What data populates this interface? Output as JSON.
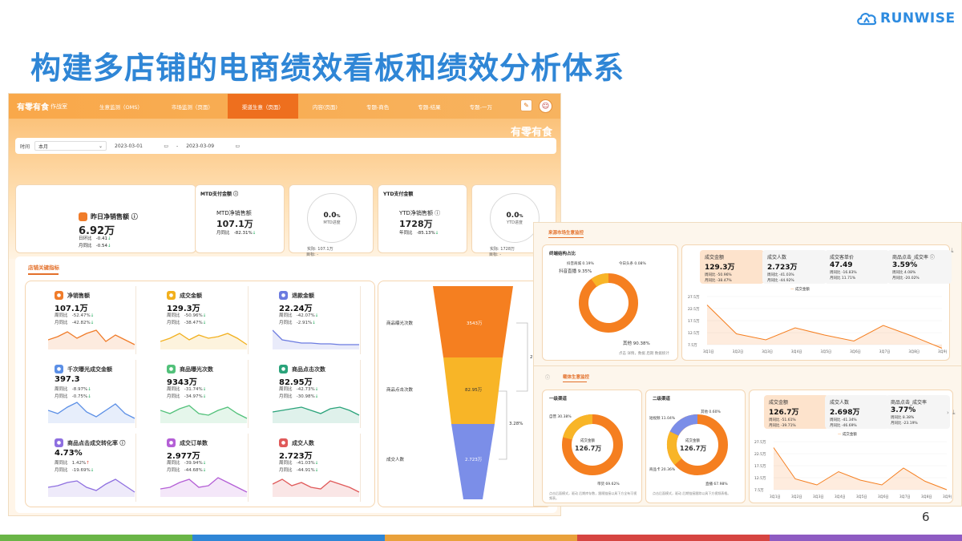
{
  "slide": {
    "title": "构建多店铺的电商绩效看板和绩效分析体系",
    "page_number": "6",
    "logo_text": "RUNWISE",
    "bottom_colors": [
      "#6ab547",
      "#2f86d6",
      "#e9a13b",
      "#d64541",
      "#8e5bc2"
    ]
  },
  "dashboard": {
    "brand": "有零有食",
    "workbench": "作战室",
    "nav": [
      "生意监测（OMS）",
      "市场监测（页面）",
      "渠道生意（页面）",
      "内容(页面)",
      "专题-商色",
      "专题-结果",
      "专题-一万"
    ],
    "active_nav": 2,
    "hero_brand": "有零有食",
    "filter": {
      "time_label": "时间",
      "period": "本月",
      "start": "2023-03-01",
      "sep": "-",
      "end": "2023-03-09"
    },
    "yesterday": {
      "label": "昨日净销售额 ⓘ",
      "value": "6.92万",
      "r1_label": "日环比",
      "r1_val": "-0.41",
      "r2_label": "月同比",
      "r2_val": "-0.54"
    },
    "mtd": {
      "title": "MTD支付金额 ⓘ",
      "label": "MTD净销售额",
      "value": "107.1万",
      "r_label": "月同比",
      "r_val": "-82.31%",
      "ring_value": "0.0",
      "ring_unit": "%",
      "ring_label": "MTD进度",
      "actual": "实际: 107.1万",
      "target": "目标: -"
    },
    "ytd": {
      "title": "YTD支付金额",
      "label": "YTD净销售额 ⓘ",
      "value": "1728万",
      "r_label": "年同比",
      "r_val": "-85.13%",
      "ring_value": "0.0",
      "ring_unit": "%",
      "ring_label": "YTD进度",
      "actual": "实际: 1728万",
      "target": "目标: -"
    },
    "section_title": "店铺关键指标",
    "metrics": [
      {
        "label": "净销售额",
        "value": "107.1万",
        "r1": "周同比",
        "r1v": "-52.47%",
        "r2": "月同比",
        "r2v": "-42.82%",
        "color": "#f07c2a",
        "r1dir": "down",
        "r2dir": "down"
      },
      {
        "label": "成交金额",
        "value": "129.3万",
        "r1": "周同比",
        "r1v": "-50.96%",
        "r2": "月同比",
        "r2v": "-38.47%",
        "color": "#f2b01e",
        "r1dir": "down",
        "r2dir": "down"
      },
      {
        "label": "退款金额",
        "value": "22.24万",
        "r1": "周同比",
        "r1v": "-42.07%",
        "r2": "月同比",
        "r2v": "-2.91%",
        "color": "#6b7be0",
        "r1dir": "down",
        "r2dir": "down"
      },
      {
        "label": "千次曝光成交金额",
        "value": "397.3",
        "r1": "周同比",
        "r1v": "-8.97%",
        "r2": "月同比",
        "r2v": "-0.75%",
        "color": "#5b8fe6",
        "r1dir": "down",
        "r2dir": "down"
      },
      {
        "label": "商品曝光次数",
        "value": "9343万",
        "r1": "周同比",
        "r1v": "-31.74%",
        "r2": "月同比",
        "r2v": "-34.97%",
        "color": "#52c17a",
        "r1dir": "down",
        "r2dir": "down"
      },
      {
        "label": "商品点击次数",
        "value": "82.95万",
        "r1": "周同比",
        "r1v": "-42.73%",
        "r2": "月同比",
        "r2v": "-30.98%",
        "color": "#2aa37a",
        "r1dir": "down",
        "r2dir": "down"
      },
      {
        "label": "商品点击成交转化率 ⓘ",
        "value": "4.73%",
        "r1": "周同比",
        "r1v": "1.42%",
        "r2": "月同比",
        "r2v": "-19.69%",
        "color": "#8e6fe0",
        "r1dir": "up",
        "r2dir": "down"
      },
      {
        "label": "成交订单数",
        "value": "2.977万",
        "r1": "周同比",
        "r1v": "-39.94%",
        "r2": "月同比",
        "r2v": "-44.68%",
        "color": "#b45fd6",
        "r1dir": "down",
        "r2dir": "down"
      },
      {
        "label": "成交人数",
        "value": "2.723万",
        "r1": "周同比",
        "r1v": "-41.03%",
        "r2": "月同比",
        "r2v": "-44.91%",
        "color": "#e05a5a",
        "r1dir": "down",
        "r2dir": "down"
      }
    ],
    "funnel": {
      "stages": [
        {
          "label": "商品曝光次数",
          "value": "3543万"
        },
        {
          "label": "商品点击次数",
          "value": "82.95万"
        },
        {
          "label": "成交人数",
          "value": "2.723万"
        }
      ],
      "rates": [
        "2.34%",
        "3.28%"
      ]
    }
  },
  "right_panel": {
    "tab1": "来源市场生意监控",
    "donut1": {
      "title": "终端结构占比",
      "labels": [
        "其他 90.38%",
        "抖音直播 9.35%",
        "抖音商城 0.19%",
        "今日头条 0.08%"
      ],
      "note": "点击 详情，数据 后期 数据统计"
    },
    "kpis1": [
      {
        "t": "成交金额",
        "v": "129.3万",
        "r1": "周同比 -50.96%",
        "r2": "月同比 -38.47%"
      },
      {
        "t": "成交人数",
        "v": "2.723万",
        "r1": "周同比 -41.03%",
        "r2": "月同比 -44.92%"
      },
      {
        "t": "成交客单价",
        "v": "47.49",
        "r1": "周同比 -16.83%",
        "r2": "月同比 11.71%"
      },
      {
        "t": "商品点击_成交率 ⓘ",
        "v": "3.59%",
        "r1": "周同比 4.08%",
        "r2": "月同比 -20.02%"
      }
    ],
    "chart1_legend": "成交金额",
    "tab2": "载体生意监控",
    "donut2": {
      "title": "一级渠道",
      "center_label": "成交金额",
      "center_value": "126.7万",
      "labels": [
        "自营 30.38%",
        "带货 69.62%"
      ],
      "note": "点击后面模式，驱动 后期库存数，跟随链接以具下方全有可视频表。"
    },
    "donut3": {
      "title": "二级渠道",
      "center_label": "成交金额",
      "center_value": "126.7万",
      "labels": [
        "其他 0.60%",
        "短视频 11.04%",
        "商品卡 20.36%",
        "直播 67.98%"
      ],
      "note": "点击后面模式，驱动 后期链接跟踪以具下方视频表格。"
    },
    "kpis2": [
      {
        "t": "成交金额",
        "v": "126.7万",
        "r1": "周同比 -51.61%",
        "r2": "月同比 -39.71%"
      },
      {
        "t": "成交人数",
        "v": "2.698万",
        "r1": "周同比 -41.34%",
        "r2": "月同比 -46.69%"
      },
      {
        "t": "商品点击_成交率",
        "v": "3.77%",
        "r1": "周同比 8.38%",
        "r2": "月同比 -23.19%"
      }
    ],
    "chart2_legend": "成交金额",
    "y_ticks1": [
      "27.5万",
      "22.5万",
      "17.5万",
      "12.5万",
      "7.5万"
    ],
    "y_ticks2": [
      "27.5万",
      "22.5万",
      "17.5万",
      "12.5万",
      "7.5万"
    ],
    "x_ticks": [
      "3月1日",
      "3月2日",
      "3月3日",
      "3月4日",
      "3月5日",
      "3月6日",
      "3月7日",
      "3月8日",
      "3月9日"
    ]
  },
  "chart_data": [
    {
      "type": "line",
      "name": "成交金额",
      "x": [
        "3月1日",
        "3月2日",
        "3月3日",
        "3月4日",
        "3月5日",
        "3月6日",
        "3月7日",
        "3月8日",
        "3月9日"
      ],
      "values": [
        24,
        12,
        9.5,
        14.5,
        11.5,
        9,
        15.5,
        11,
        6
      ],
      "ylim": [
        7.5,
        27.5
      ]
    },
    {
      "type": "line",
      "name": "成交金额",
      "x": [
        "3月1日",
        "3月2日",
        "3月3日",
        "3月4日",
        "3月5日",
        "3月6日",
        "3月7日",
        "3月8日",
        "3月9日"
      ],
      "values": [
        25,
        12,
        9.5,
        15,
        11.5,
        9.5,
        16.5,
        11,
        7.5
      ],
      "ylim": [
        7.5,
        27.5
      ]
    }
  ]
}
